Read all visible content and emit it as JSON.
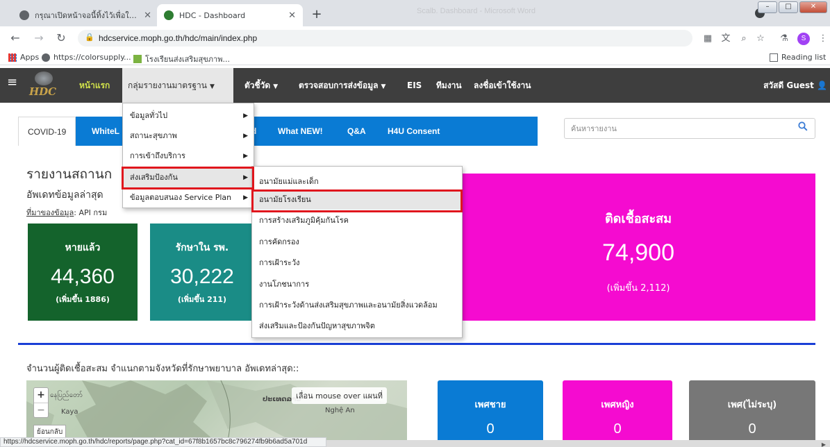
{
  "browser": {
    "tabs": [
      {
        "title": "กรุณาเปิดหน้าจอนี้ทิ้งไว้เพื่อใช้งาน Inte",
        "active": false
      },
      {
        "title": "HDC - Dashboard",
        "active": true
      }
    ],
    "new_tab_symbol": "+",
    "window_title_faded": "Scalb. Dashboard - Microsoft Word",
    "url": "hdcservice.moph.go.th/hdc/main/index.php",
    "profile_initial": "S",
    "bookmarks": {
      "apps": "Apps",
      "colorsupply": "https://colorsupply...",
      "school": "โรงเรียนส่งเสริมสุขภาพ...",
      "reading_list": "Reading list"
    },
    "status_url": "https://hdcservice.moph.go.th/hdc/reports/page.php?cat_id=67f8b1657bc8c796274fb9b6ad5a701d"
  },
  "navbar": {
    "home": "หน้าแรก",
    "standard_reports": "กลุ่มรายงานมาตรฐาน",
    "indicators": "ตัวชี้วัด",
    "check_data": "ตรวจสอบการส่งข้อมูล",
    "eis": "EIS",
    "team": "ทีมงาน",
    "login": "ลงชื่อเข้าใช้งาน",
    "greeting": "สวัสดี Guest"
  },
  "tabs": {
    "covid": "COVID-19",
    "white": "WhiteL",
    "d": "d",
    "whatnew": "What NEW!",
    "qa": "Q&A",
    "h4u": "H4U Consent"
  },
  "search": {
    "placeholder": "ค้นหารายงาน"
  },
  "headings": {
    "report": "รายงานสถานก",
    "update": "อัพเดทข้อมูลล่าสุด",
    "source_label": "ที่มาของข้อมูล",
    "source_value": ": API กรม"
  },
  "cards": {
    "recovered": {
      "label": "หายแล้ว",
      "value": "44,360",
      "delta": "(เพิ่มขึ้น 1886)"
    },
    "hospital": {
      "label": "รักษาใน รพ.",
      "value": "30,222",
      "delta": "(เพิ่มขึ้น 211)"
    },
    "cumulative": {
      "label": "ติดเชื้อสะสม",
      "value": "74,900",
      "delta": "(เพิ่มขึ้น 2,112)"
    }
  },
  "province_title": "จำนวนผู้ติดเชื้อสะสม จำแนกตามจังหวัดที่รักษาพยาบาล อัพเดทล่าสุด::",
  "map": {
    "zoom_in": "+",
    "zoom_out": "−",
    "back": "ย้อนกลับ",
    "hint": "เลื่อน mouse over แผนที่",
    "places": {
      "a": "နေပြည်တော်",
      "b": "Kaya",
      "c": "ປະເທດລາວ",
      "d": "Nghệ An"
    }
  },
  "gender": {
    "male": {
      "label": "เพศชาย",
      "value": "0"
    },
    "female": {
      "label": "เพศหญิง",
      "value": "0"
    },
    "unknown": {
      "label": "เพศ(ไม่ระบุ)",
      "value": "0"
    }
  },
  "menu_main": [
    "ข้อมูลทั่วไป",
    "สถานะสุขภาพ",
    "การเข้าถึงบริการ",
    "ส่งเสริมป้องกัน",
    "ข้อมูลตอบสนอง Service Plan"
  ],
  "menu_sub": [
    "อนามัยแม่และเด็ก",
    "อนามัยโรงเรียน",
    "การสร้างเสริมภูมิคุ้มกันโรค",
    "การคัดกรอง",
    "การเฝ้าระวัง",
    "งานโภชนาการ",
    "การเฝ้าระวังด้านส่งเสริมสุขภาพและอนามัยสิ่งแวดล้อม",
    "ส่งเสริมและป้องกันปัญหาสุขภาพจิต"
  ],
  "colors": {
    "nav_bg": "#3e3e3e",
    "tab_blue": "#0a7bd4",
    "green_card": "#14632c",
    "teal_card": "#1a8c86",
    "magenta_card": "#f50bd0",
    "highlight_red": "#e0161d"
  }
}
